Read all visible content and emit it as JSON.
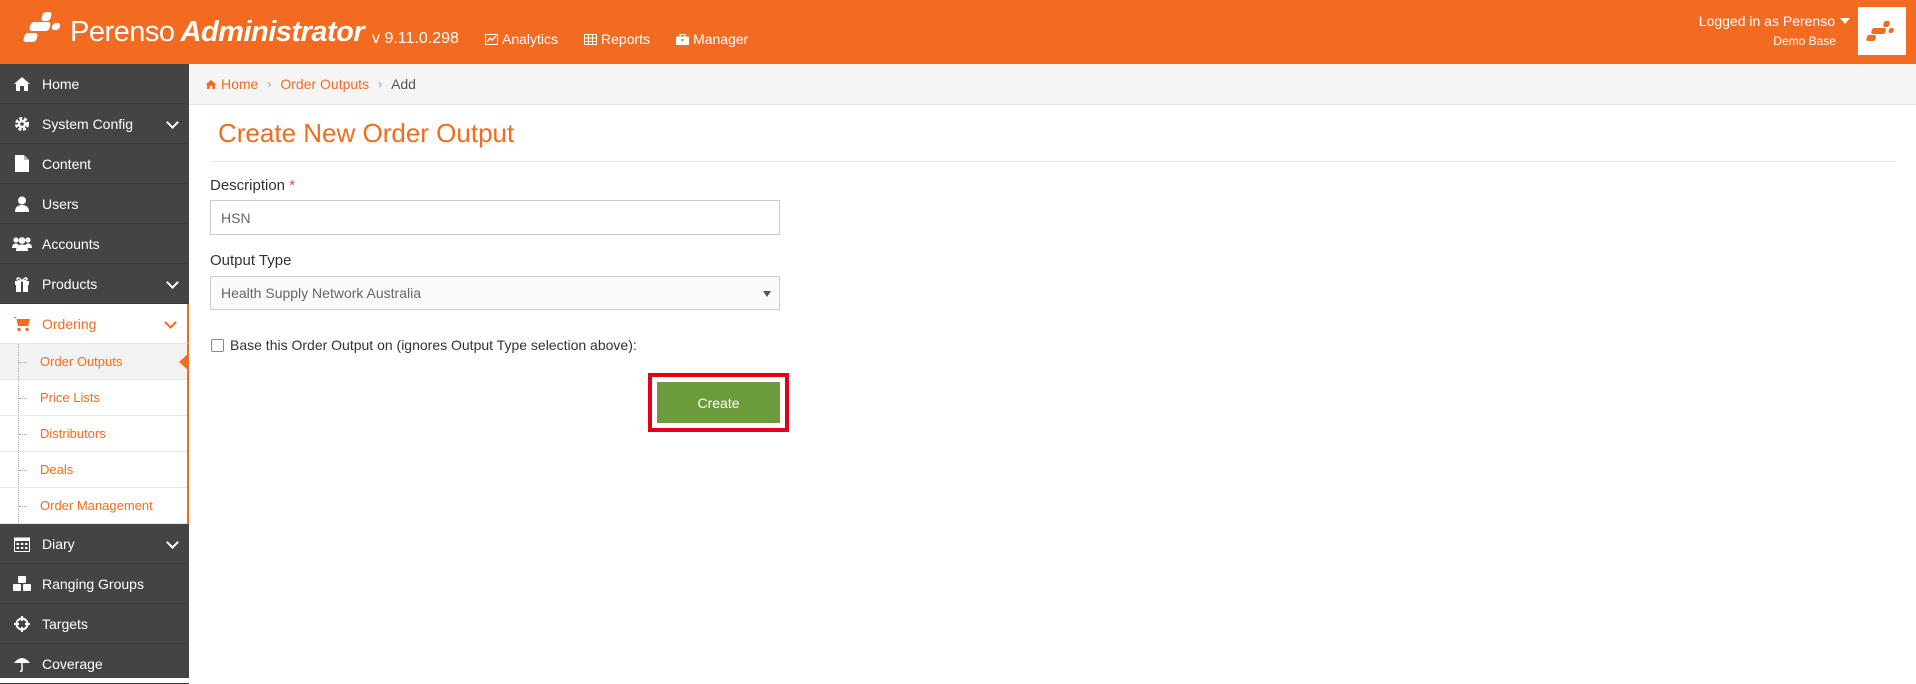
{
  "header": {
    "brand_name": "Perenso",
    "brand_suffix": "Administrator",
    "version": "v 9.11.0.298",
    "nav": [
      {
        "label": "Analytics",
        "icon": "chart-icon"
      },
      {
        "label": "Reports",
        "icon": "table-icon"
      },
      {
        "label": "Manager",
        "icon": "briefcase-icon"
      }
    ],
    "user_text": "Logged in as Perenso",
    "database": "Demo Base"
  },
  "sidebar": {
    "items": [
      {
        "label": "Home",
        "icon": "home-icon"
      },
      {
        "label": "System Config",
        "icon": "gear-icon"
      },
      {
        "label": "Content",
        "icon": "file-icon"
      },
      {
        "label": "Users",
        "icon": "user-icon"
      },
      {
        "label": "Accounts",
        "icon": "users-icon"
      },
      {
        "label": "Products",
        "icon": "gift-icon"
      },
      {
        "label": "Ordering",
        "icon": "cart-icon"
      },
      {
        "label": "Diary",
        "icon": "calendar-icon"
      },
      {
        "label": "Ranging Groups",
        "icon": "cubes-icon"
      },
      {
        "label": "Targets",
        "icon": "crosshairs-icon"
      },
      {
        "label": "Coverage",
        "icon": "umbrella-icon"
      }
    ],
    "ordering_submenu": [
      {
        "label": "Order Outputs"
      },
      {
        "label": "Price Lists"
      },
      {
        "label": "Distributors"
      },
      {
        "label": "Deals"
      },
      {
        "label": "Order Management"
      }
    ]
  },
  "breadcrumb": {
    "home": "Home",
    "section": "Order Outputs",
    "current": "Add"
  },
  "page": {
    "title": "Create New Order Output",
    "description_label": "Description",
    "required_mark": "*",
    "description_value": "HSN",
    "output_type_label": "Output Type",
    "output_type_value": "Health Supply Network Australia",
    "base_checkbox_label": "Base this Order Output on (ignores Output Type selection above):",
    "create_button": "Create"
  },
  "colors": {
    "accent": "#f26b21",
    "sidebar_bg": "#444444",
    "button_green": "#6b9b3a",
    "highlight_red": "#e4001b"
  }
}
